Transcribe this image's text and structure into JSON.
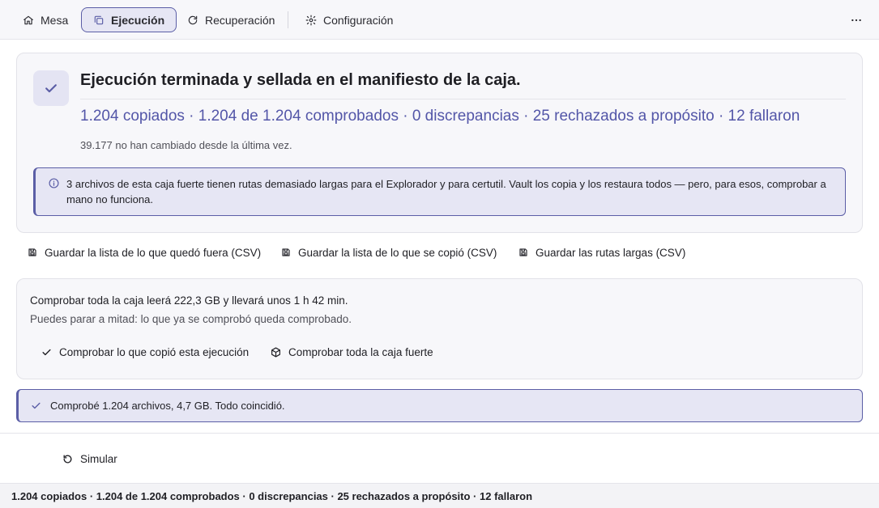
{
  "nav": {
    "tabs": [
      {
        "label": "Mesa",
        "icon": "home-icon",
        "active": false
      },
      {
        "label": "Ejecución",
        "icon": "copy-icon",
        "active": true
      },
      {
        "label": "Recuperación",
        "icon": "refresh-icon",
        "active": false
      },
      {
        "label": "Configuración",
        "icon": "settings-icon",
        "active": false
      }
    ],
    "more_icon": "more-horizontal-icon"
  },
  "summary": {
    "headline": "Ejecución terminada y sellada en el manifiesto de la caja.",
    "stats": "1.204 copiados · 1.204 de 1.204 comprobados · 0 discrepancias · 25 rechazados a propósito · 12 fallaron",
    "unchanged": "39.177 no han cambiado desde la última vez.",
    "callout": "3 archivos de esta caja fuerte tienen rutas demasiado largas para el Explorador y para certutil. Vault los copia y los restaura todos — pero, para esos, comprobar a mano no funciona."
  },
  "exports": [
    {
      "label": "Guardar la lista de lo que quedó fuera (CSV)",
      "icon": "save-icon"
    },
    {
      "label": "Guardar la lista de lo que se copió (CSV)",
      "icon": "save-icon"
    },
    {
      "label": "Guardar las rutas largas (CSV)",
      "icon": "save-icon"
    }
  ],
  "verify": {
    "estimate": "Comprobar toda la caja leerá 222,3 GB y llevará unos 1 h 42 min.",
    "note": "Puedes parar a mitad: lo que ya se comprobó queda comprobado.",
    "run_button": "Comprobar lo que copió esta ejecución",
    "vault_button": "Comprobar toda la caja fuerte"
  },
  "result": "Comprobé 1.204 archivos, 4,7 GB. Todo coincidió.",
  "simulate_label": "Simular",
  "status_bar": "1.204 copiados · 1.204 de 1.204 comprobados · 0 discrepancias · 25 rechazados a propósito · 12 fallaron",
  "colors": {
    "accent": "#5b5ea6",
    "accent_text": "#5356a8",
    "accent_bg": "#e6e6f4"
  }
}
